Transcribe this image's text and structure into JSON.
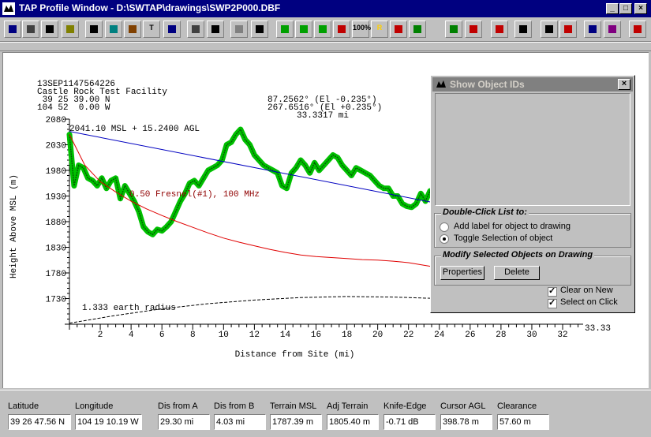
{
  "window": {
    "title": "TAP Profile Window - D:\\SWTAP\\drawings\\SWP2P000.DBF",
    "min": "_",
    "max": "□",
    "close": "×"
  },
  "toolbar": {
    "items": [
      {
        "name": "save",
        "icon": "floppy-icon"
      },
      {
        "name": "print",
        "icon": "printer-icon"
      },
      {
        "name": "export",
        "icon": "arrow-export-icon"
      },
      {
        "name": "edit",
        "icon": "edit-doc-icon"
      },
      {
        "name": "select",
        "icon": "pointer-icon"
      },
      {
        "name": "layers",
        "icon": "layers-icon"
      },
      {
        "name": "clipboard",
        "icon": "clipboard-icon"
      },
      {
        "name": "text",
        "icon": "text-icon",
        "label": "T"
      },
      {
        "name": "info",
        "icon": "info-icon"
      },
      {
        "name": "measure",
        "icon": "measure-icon"
      },
      {
        "name": "search",
        "icon": "search-icon"
      },
      {
        "name": "delete",
        "icon": "delete-icon"
      },
      {
        "name": "insert",
        "icon": "insert-icon"
      },
      {
        "name": "green1",
        "icon": "green-play-icon"
      },
      {
        "name": "green2",
        "icon": "green-square-icon"
      },
      {
        "name": "pin",
        "icon": "pin-icon"
      },
      {
        "name": "red-green",
        "icon": "red-green-icon"
      },
      {
        "name": "zoom100",
        "icon": "zoom-100-icon",
        "label": "100%"
      },
      {
        "name": "r",
        "icon": "r-icon",
        "label": "R"
      },
      {
        "name": "rb",
        "icon": "rb-icon"
      },
      {
        "name": "rg",
        "icon": "rg-icon"
      },
      {
        "name": "line1",
        "icon": "line-icon"
      },
      {
        "name": "area",
        "icon": "area-icon"
      },
      {
        "name": "diag",
        "icon": "diag-icon"
      },
      {
        "name": "tools",
        "icon": "tools-icon"
      },
      {
        "name": "crosshair",
        "icon": "crosshair-icon"
      },
      {
        "name": "colors",
        "icon": "colors-icon"
      },
      {
        "name": "grid",
        "icon": "grid-icon"
      },
      {
        "name": "grid2",
        "icon": "grid-color-icon"
      },
      {
        "name": "barchart",
        "icon": "bar-chart-icon"
      }
    ]
  },
  "header_text": {
    "date": "13SEP1147564226",
    "site": "Castle Rock Test Facility",
    "lat": " 39 25 39.00 N",
    "lon": "104 52  0.00 W",
    "az1": "87.2562° (El -0.235°)",
    "az2": "267.6516° (El +0.235°)",
    "dist": "33.3317 mi",
    "antenna": "2041.10 MSL + 15.2400 AGL",
    "fresnel": "0.50 Fresnel(#1), 100 MHz",
    "earth": "1.333 earth radius"
  },
  "chart_data": {
    "type": "line",
    "xlabel": "Distance from Site (mi)",
    "ylabel": "Height Above MSL (m)",
    "xlim": [
      0,
      33.33
    ],
    "ylim": [
      1680,
      2080
    ],
    "x_ticks": [
      "2",
      "4",
      "6",
      "8",
      "10",
      "12",
      "14",
      "16",
      "18",
      "20",
      "22",
      "24",
      "26",
      "28",
      "30",
      "32"
    ],
    "x_end_label": "33.33",
    "y_ticks": [
      "2080",
      "2030",
      "1980",
      "1930",
      "1880",
      "1830",
      "1780",
      "1730"
    ],
    "series": [
      {
        "name": "terrain",
        "color": "#00a000",
        "x": [
          0,
          0.3,
          0.6,
          0.9,
          1.2,
          1.5,
          1.8,
          2.1,
          2.4,
          2.7,
          3.0,
          3.3,
          3.6,
          3.9,
          4.2,
          4.5,
          4.8,
          5.1,
          5.4,
          5.7,
          6.0,
          6.3,
          6.6,
          6.9,
          7.2,
          7.5,
          7.8,
          8.1,
          8.4,
          8.7,
          9.0,
          9.3,
          9.6,
          9.9,
          10.2,
          10.5,
          10.8,
          11.1,
          11.4,
          11.7,
          12.0,
          12.3,
          12.6,
          12.9,
          13.2,
          13.5,
          13.8,
          14.1,
          14.4,
          14.7,
          15.0,
          15.3,
          15.6,
          15.9,
          16.2,
          16.5,
          16.8,
          17.1,
          17.4,
          17.7,
          18.0,
          18.3,
          18.6,
          18.9,
          19.2,
          19.5,
          19.8,
          20.1,
          20.4,
          20.7,
          21.0,
          21.3,
          21.6,
          21.9,
          22.2,
          22.5,
          22.8,
          23.1,
          23.4,
          23.7,
          24.0
        ],
        "values": [
          2050,
          1950,
          1990,
          1985,
          1965,
          1960,
          1950,
          1965,
          1945,
          1960,
          1965,
          1925,
          1950,
          1935,
          1920,
          1900,
          1870,
          1860,
          1855,
          1865,
          1862,
          1870,
          1880,
          1900,
          1920,
          1935,
          1955,
          1960,
          1950,
          1965,
          1980,
          1985,
          1990,
          2000,
          2030,
          2035,
          2050,
          2060,
          2040,
          2030,
          2010,
          2000,
          1990,
          1985,
          1980,
          1975,
          1950,
          1945,
          1975,
          1985,
          2000,
          1990,
          1975,
          1995,
          1980,
          1990,
          2000,
          2010,
          2005,
          1990,
          1980,
          1970,
          1985,
          1980,
          1975,
          1970,
          1960,
          1950,
          1945,
          1945,
          1930,
          1930,
          1915,
          1910,
          1908,
          1915,
          1935,
          1920,
          1940,
          1928,
          1920
        ]
      },
      {
        "name": "line-of-sight",
        "color": "#0000c0",
        "x": [
          0,
          24
        ],
        "values": [
          2056,
          1915
        ]
      },
      {
        "name": "fresnel",
        "color": "#e00000",
        "x": [
          0,
          1,
          2,
          3,
          4,
          5,
          6,
          7,
          8,
          9,
          10,
          11,
          12,
          13,
          14,
          15,
          16,
          17,
          18,
          19,
          20,
          21,
          22,
          23,
          24
        ],
        "values": [
          2050,
          1990,
          1958,
          1938,
          1920,
          1905,
          1892,
          1880,
          1869,
          1858,
          1848,
          1840,
          1833,
          1826,
          1820,
          1815,
          1812,
          1810,
          1808,
          1806,
          1805,
          1803,
          1800,
          1795,
          1790
        ]
      },
      {
        "name": "earth-curve",
        "color": "#000000",
        "x": [
          0,
          3,
          6,
          9,
          12,
          15,
          18,
          21,
          24,
          27,
          30,
          33.33
        ],
        "values": [
          1682,
          1697,
          1710,
          1720,
          1727,
          1732,
          1734,
          1733,
          1730,
          1725,
          1717,
          1705
        ]
      }
    ]
  },
  "dialog": {
    "title": "Show Object IDs",
    "close": "×",
    "group1_title": "Double-Click List to:",
    "radio1": "Add label for object to drawing",
    "radio2": "Toggle Selection of  object",
    "group2_title": "Modify Selected Objects on Drawing",
    "btn_properties": "Properties",
    "btn_delete": "Delete",
    "chk_clear": "Clear on New",
    "chk_select": "Select on Click",
    "check_mark": "✓"
  },
  "status": {
    "fields": [
      {
        "label": "Latitude",
        "value": "39 26 47.56 N"
      },
      {
        "label": "Longitude",
        "value": "104 19 10.19 W"
      },
      {
        "label": "Dis from A",
        "value": "29.30 mi"
      },
      {
        "label": "Dis from B",
        "value": "4.03 mi"
      },
      {
        "label": "Terrain MSL",
        "value": "1787.39 m"
      },
      {
        "label": "Adj Terrain",
        "value": "1805.40 m"
      },
      {
        "label": "Knife-Edge",
        "value": "-0.71 dB"
      },
      {
        "label": "Cursor AGL",
        "value": "398.78 m"
      },
      {
        "label": "Clearance",
        "value": "57.60 m"
      }
    ]
  }
}
